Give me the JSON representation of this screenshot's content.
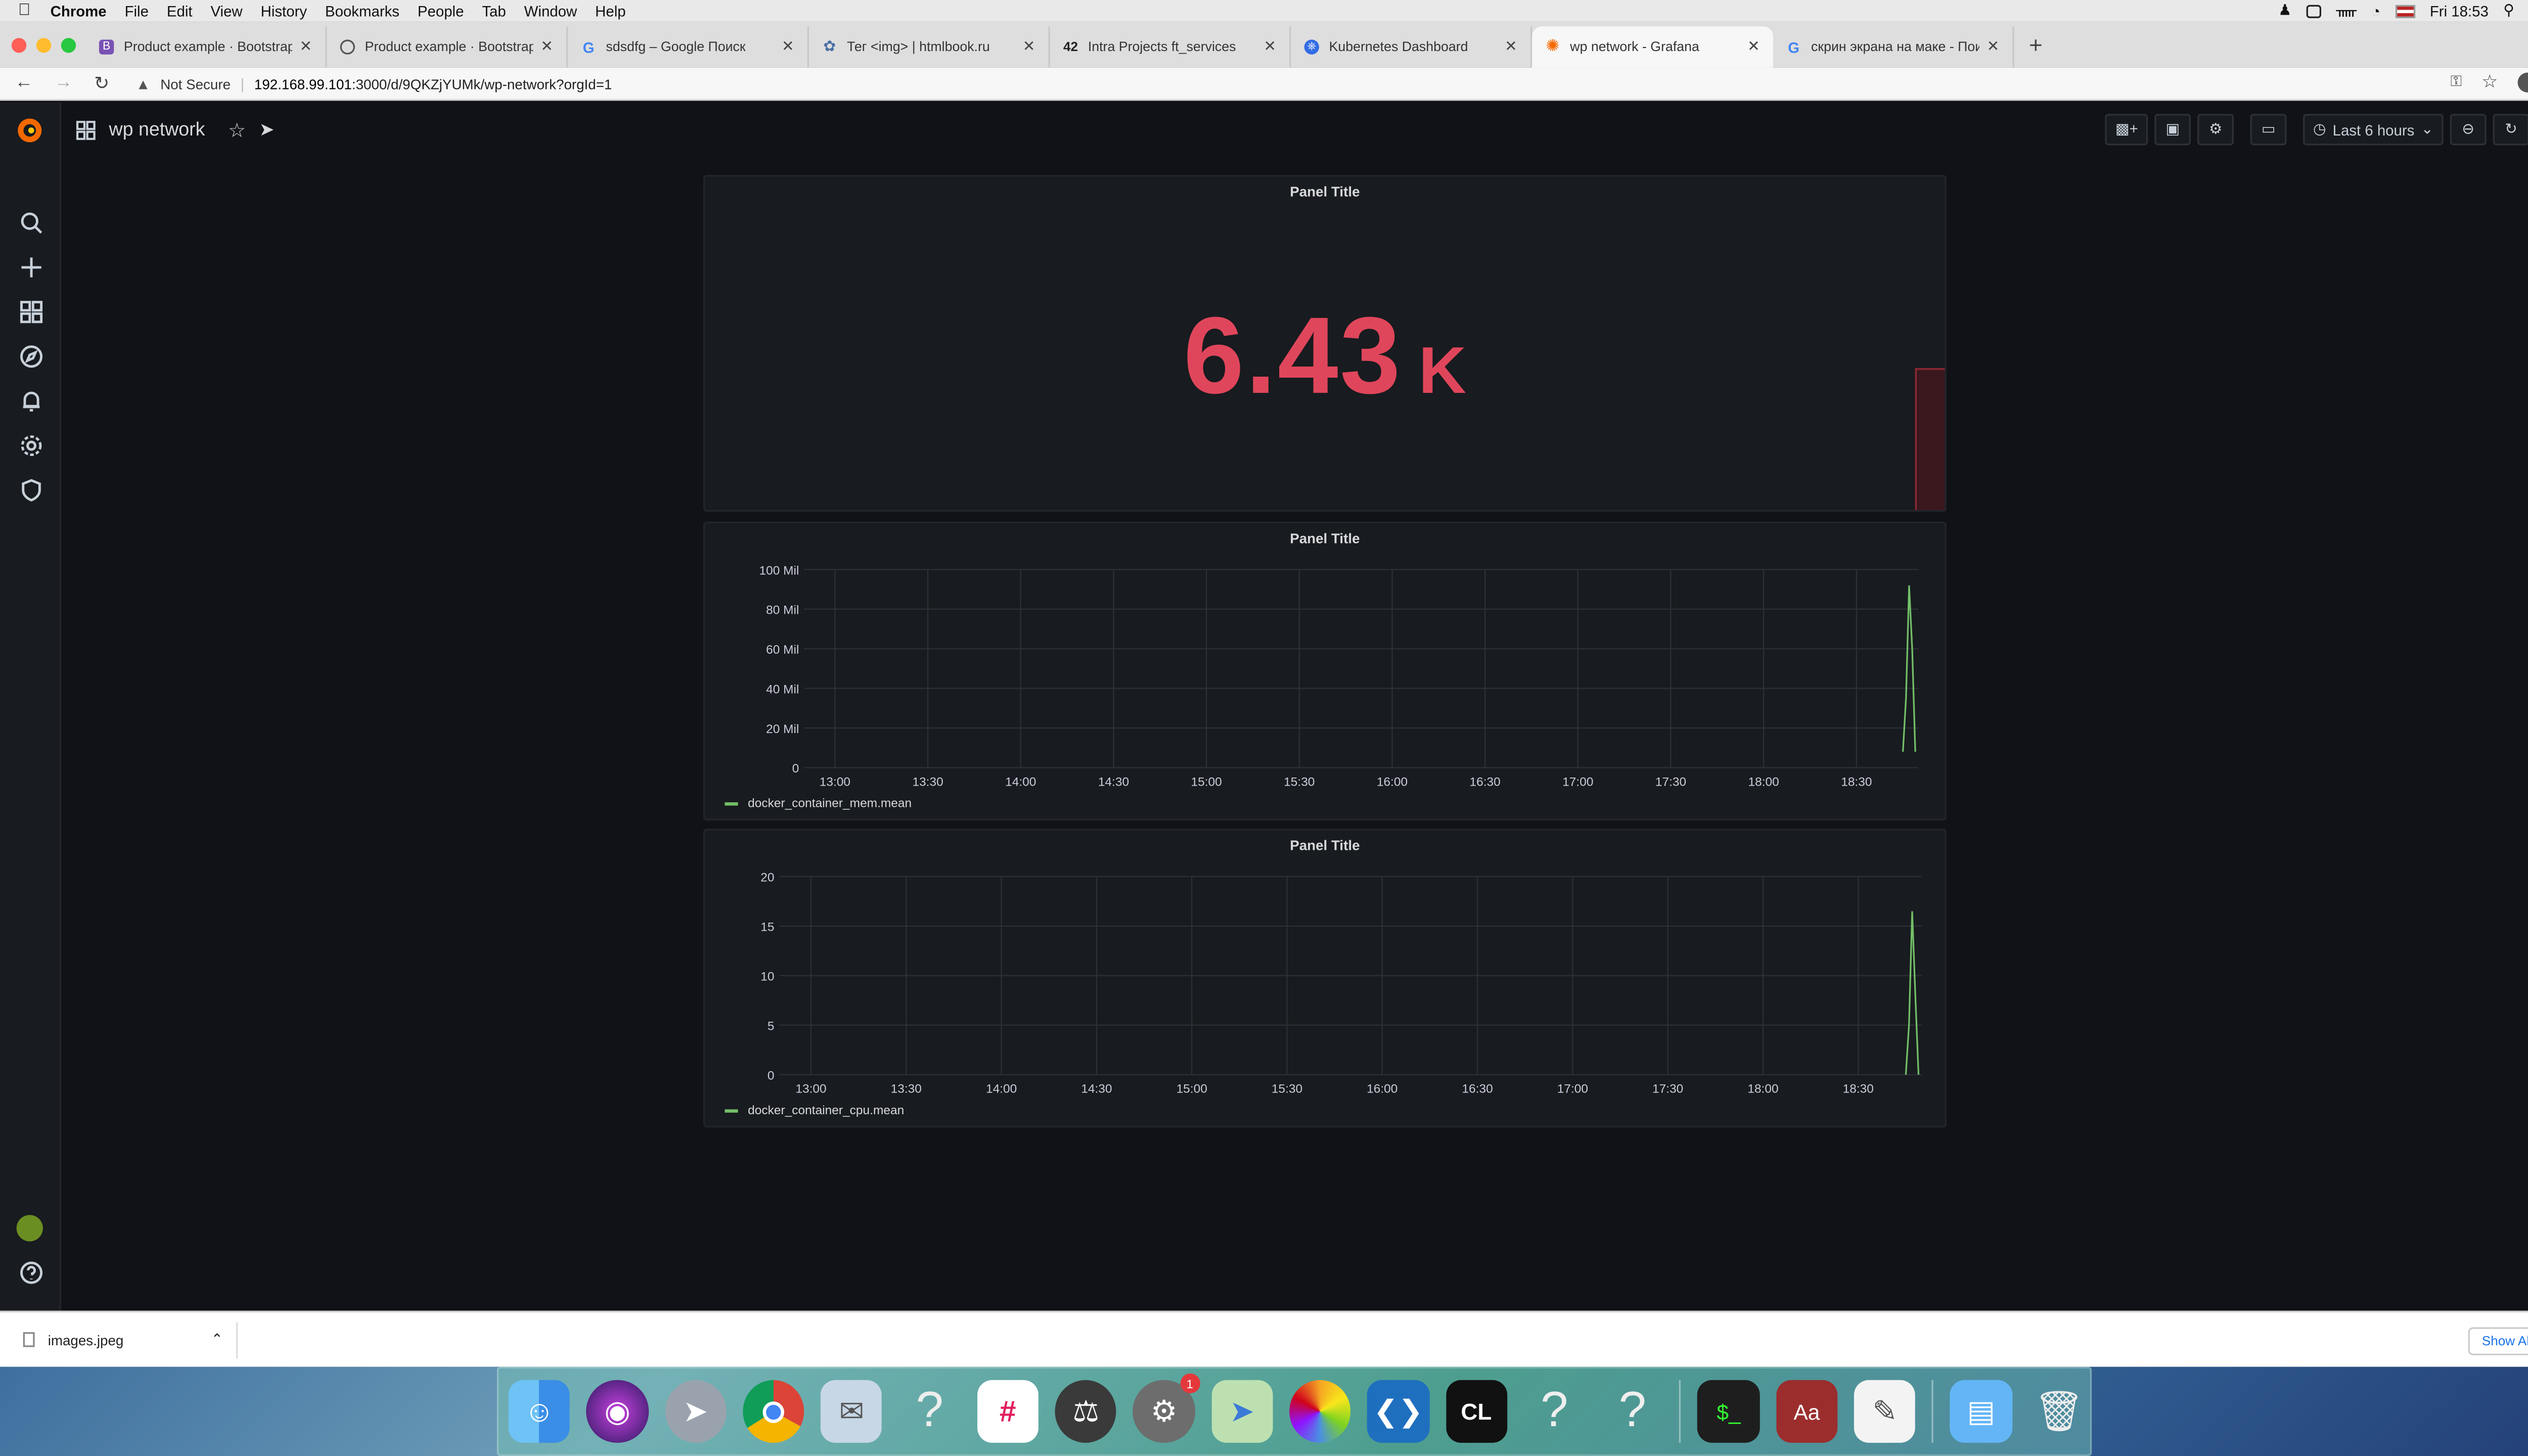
{
  "menubar": {
    "app": "Chrome",
    "menus": [
      "File",
      "Edit",
      "View",
      "History",
      "Bookmarks",
      "People",
      "Tab",
      "Window",
      "Help"
    ],
    "clock": "Fri 18:53"
  },
  "browser": {
    "tabs": [
      {
        "title": "Product example · Bootstrap v",
        "favicon": "bootstrap-icon",
        "color": "#7952b3"
      },
      {
        "title": "Product example · Bootstrap v",
        "favicon": "globe-icon",
        "color": "#666666"
      },
      {
        "title": "sdsdfg – Google Поиск",
        "favicon": "google-icon",
        "color": "#4285f4"
      },
      {
        "title": "Тег <img> | htmlbook.ru",
        "favicon": "htmlbook-icon",
        "color": "#4a6fa5"
      },
      {
        "title": "Intra Projects ft_services",
        "favicon": "42-icon",
        "color": "#222222"
      },
      {
        "title": "Kubernetes Dashboard",
        "favicon": "kubernetes-icon",
        "color": "#326ce5"
      },
      {
        "title": "wp network - Grafana",
        "favicon": "grafana-icon",
        "color": "#f46800",
        "active": true
      },
      {
        "title": "скрин экрана на маке - Поис",
        "favicon": "google-icon",
        "color": "#4285f4"
      }
    ],
    "security": "Not Secure",
    "url_host": "192.168.99.101",
    "url_rest": ":3000/d/9QKZjYUMk/wp-network?orgId=1"
  },
  "grafana": {
    "dashboard_title": "wp network",
    "time_range": "Last 6 hours",
    "panels": [
      {
        "title": "Panel Title",
        "type": "stat",
        "value": "6.43",
        "unit": "K"
      },
      {
        "title": "Panel Title",
        "type": "graph",
        "legend": "docker_container_mem.mean"
      },
      {
        "title": "Panel Title",
        "type": "graph",
        "legend": "docker_container_cpu.mean"
      }
    ]
  },
  "chart_data": [
    {
      "type": "line",
      "title": "Panel Title",
      "series": [
        {
          "name": "docker_container_mem.mean",
          "color": "#73bf69",
          "x": [
            "18:45",
            "18:46",
            "18:47",
            "18:48",
            "18:49"
          ],
          "y": [
            8,
            35,
            92,
            60,
            8
          ]
        }
      ],
      "x_ticks": [
        "13:00",
        "13:30",
        "14:00",
        "14:30",
        "15:00",
        "15:30",
        "16:00",
        "16:30",
        "17:00",
        "17:30",
        "18:00",
        "18:30"
      ],
      "y_ticks": [
        "0",
        "20 Mil",
        "40 Mil",
        "60 Mil",
        "80 Mil",
        "100 Mil"
      ],
      "ylim": [
        0,
        100
      ],
      "grid": true,
      "legend": "bottom-left"
    },
    {
      "type": "line",
      "title": "Panel Title",
      "series": [
        {
          "name": "docker_container_cpu.mean",
          "color": "#73bf69",
          "x": [
            "18:45",
            "18:46",
            "18:47",
            "18:48",
            "18:49"
          ],
          "y": [
            0,
            5,
            16.5,
            8,
            0
          ]
        }
      ],
      "x_ticks": [
        "13:00",
        "13:30",
        "14:00",
        "14:30",
        "15:00",
        "15:30",
        "16:00",
        "16:30",
        "17:00",
        "17:30",
        "18:00",
        "18:30"
      ],
      "y_ticks": [
        "0",
        "5",
        "10",
        "15",
        "20"
      ],
      "ylim": [
        0,
        20
      ],
      "grid": true,
      "legend": "bottom-left"
    }
  ],
  "download": {
    "filename": "images.jpeg",
    "show_all": "Show All"
  },
  "dock": {
    "badge": "1"
  }
}
